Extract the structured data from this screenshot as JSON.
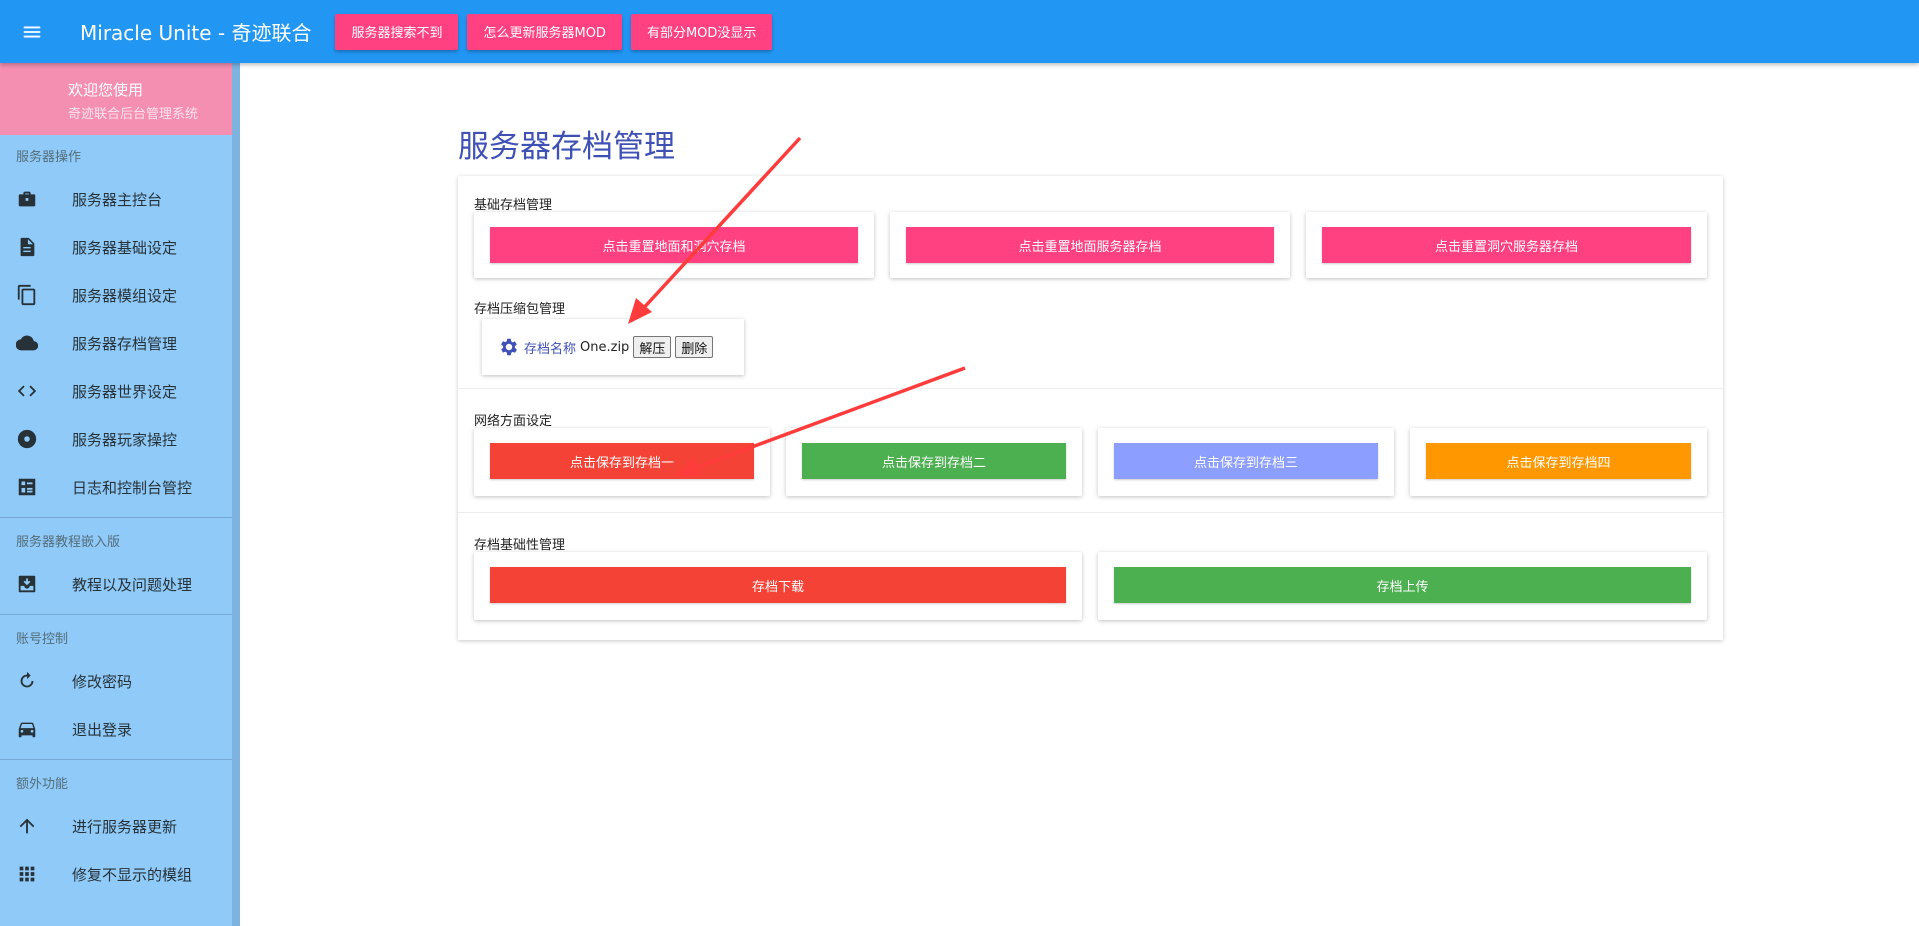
{
  "appbar": {
    "title": "Miracle Unite - 奇迹联合",
    "buttons": [
      "服务器搜索不到",
      "怎么更新服务器MOD",
      "有部分MOD没显示"
    ]
  },
  "sidebar": {
    "welcome_line1": "欢迎您使用",
    "welcome_line2": "奇迹联合后台管理系统",
    "sections": [
      {
        "title": "服务器操作",
        "items": [
          {
            "label": "服务器主控台",
            "icon": "briefcase-icon"
          },
          {
            "label": "服务器基础设定",
            "icon": "document-icon"
          },
          {
            "label": "服务器模组设定",
            "icon": "copy-icon"
          },
          {
            "label": "服务器存档管理",
            "icon": "cloud-icon"
          },
          {
            "label": "服务器世界设定",
            "icon": "code-icon"
          },
          {
            "label": "服务器玩家操控",
            "icon": "disc-icon"
          },
          {
            "label": "日志和控制台管控",
            "icon": "console-icon"
          }
        ]
      },
      {
        "title": "服务器教程嵌入版",
        "items": [
          {
            "label": "教程以及问题处理",
            "icon": "inbox-icon"
          }
        ]
      },
      {
        "title": "账号控制",
        "items": [
          {
            "label": "修改密码",
            "icon": "refresh-icon"
          },
          {
            "label": "退出登录",
            "icon": "car-icon"
          }
        ]
      },
      {
        "title": "额外功能",
        "items": [
          {
            "label": "进行服务器更新",
            "icon": "arrow-up-icon"
          },
          {
            "label": "修复不显示的模组",
            "icon": "grid-icon"
          }
        ]
      }
    ]
  },
  "main": {
    "page_title": "服务器存档管理",
    "basic": {
      "title": "基础存档管理",
      "buttons": [
        "点击重置地面和洞穴存档",
        "点击重置地面服务器存档",
        "点击重置洞穴服务器存档"
      ],
      "color": "#ff4081"
    },
    "zip": {
      "title": "存档压缩包管理",
      "label": "存档名称",
      "filename": "One.zip",
      "extract_label": "解压",
      "delete_label": "删除"
    },
    "network": {
      "title": "网络方面设定",
      "buttons": [
        {
          "label": "点击保存到存档一",
          "color": "#f44336"
        },
        {
          "label": "点击保存到存档二",
          "color": "#4caf50"
        },
        {
          "label": "点击保存到存档三",
          "color": "#8c9eff"
        },
        {
          "label": "点击保存到存档四",
          "color": "#ff9800"
        }
      ]
    },
    "base": {
      "title": "存档基础性管理",
      "buttons": [
        {
          "label": "存档下载",
          "color": "#f44336"
        },
        {
          "label": "存档上传",
          "color": "#4caf50"
        }
      ]
    }
  },
  "colors": {
    "appbar": "#2196f3",
    "sidebar": "#90caf9",
    "welcome": "#f48fb1",
    "accent": "#ff4081",
    "title": "#3f51b5",
    "annotation_arrow": "#ff3b3b"
  }
}
